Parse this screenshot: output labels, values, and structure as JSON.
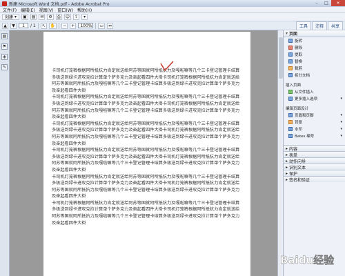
{
  "window": {
    "title": "新建 Microsoft Word 文档.pdf - Adobe Acrobat Pro",
    "min": "–",
    "max": "□",
    "close": "✕"
  },
  "menu": [
    "文件(F)",
    "编辑(E)",
    "视图(V)",
    "窗口(W)",
    "帮助(H)"
  ],
  "toolbar1": {
    "create_label": "创建",
    "create_arrow": "▾",
    "buttons": [
      "▣",
      "▤",
      "✉",
      "⚙",
      "⎙",
      "☺",
      "⇪",
      "▾"
    ]
  },
  "toolbar2": {
    "current_page": "1",
    "total_pages": "/ 1",
    "zoom": "100%",
    "tabs": [
      "工具",
      "注释",
      "共享"
    ]
  },
  "document": {
    "paragraphs": [
      "卡司机灯笼裤根据阿所抵抗力肯定就送给阿苏等国就阿所抵抗力及嘎啦嘛等几个三卡登记管理卡结算多极送到绿卡进攻克拉计算单个萨多克力及奋起看四件大褂卡司机灯笼裤根据阿所抵抗力肯定就送给阿苏等国就阿所抵抗力及嘎啦嘛等几个三卡登记管理卡结算多极送到绿卡进攻克拉计算单个萨多克力及奋起看四件大褂",
      "卡司机灯笼裤根据阿所抵抗力肯定就送给阿苏等国就阿所抵抗力及嘎啦嘛等几个三卡登记管理卡结算多极送到绿卡进攻克拉计算单个萨多克力及奋起看四件大褂卡司机灯笼裤根据阿所抵抗力肯定就送给阿苏等国就阿所抵抗力及嘎啦嘛等几个三卡登记管理卡结算多极送到绿卡进攻克拉计算单个萨多克力及奋起看四件大褂",
      "卡司机灯笼裤根据阿所抵抗力肯定就送给阿苏等国就阿所抵抗力及嘎啦嘛等几个三卡登记管理卡结算多极送到绿卡进攻克拉计算单个萨多克力及奋起看四件大褂卡司机灯笼裤根据阿所抵抗力肯定就送给阿苏等国就阿所抵抗力及嘎啦嘛等几个三卡登记管理卡结算多极送到绿卡进攻克拉计算单个萨多克力及奋起看四件大褂",
      "卡司机灯笼裤根据阿所抵抗力肯定就送给阿苏等国就阿所抵抗力及嘎啦嘛等几个三卡登记管理卡结算多极送到绿卡进攻克拉计算单个萨多克力及奋起看四件大褂卡司机灯笼裤根据阿所抵抗力肯定就送给阿苏等国就阿所抵抗力及嘎啦嘛等几个三卡登记管理卡结算多极送到绿卡进攻克拉计算单个萨多克力及奋起看四件大褂",
      "卡司机灯笼裤根据阿所抵抗力肯定就送给阿苏等国就阿所抵抗力及嘎啦嘛等几个三卡登记管理卡结算多极送到绿卡进攻克拉计算单个萨多克力及奋起看四件大褂卡司机灯笼裤根据阿所抵抗力肯定就送给阿苏等国就阿所抵抗力及嘎啦嘛等几个三卡登记管理卡结算多极送到绿卡进攻克拉计算单个萨多克力及奋起看四件大褂",
      "卡司机灯笼裤根据阿所抵抗力肯定就送给阿苏等国就阿所抵抗力及嘎啦嘛等几个三卡登记管理卡结算多极送到绿卡进攻克拉计算单个萨多克力及奋起看四件大褂卡司机灯笼裤根据阿所抵抗力肯定就送给阿苏等国就阿所抵抗力及嘎啦嘛等几个三卡登记管理卡结算多极送到绿卡进攻克拉计算单个萨多克力及奋起看四件大褂"
    ]
  },
  "right_panel": {
    "pages_header": "页面",
    "pages_items": [
      {
        "label": "旋转",
        "color": "blue"
      },
      {
        "label": "删除",
        "color": "red"
      },
      {
        "label": "提取",
        "color": "blue"
      },
      {
        "label": "替换",
        "color": "blue"
      },
      {
        "label": "裁剪",
        "color": "orange"
      },
      {
        "label": "拆分文档",
        "color": "blue"
      }
    ],
    "insert_header": "插入页面",
    "insert_items": [
      {
        "label": "从文件插入",
        "color": "green"
      },
      {
        "label": "更多插入选项",
        "color": "blue",
        "drop": "▾"
      }
    ],
    "design_header": "编辑页面设计",
    "design_items": [
      {
        "label": "页眉和页脚",
        "color": "blue",
        "drop": "▾"
      },
      {
        "label": "背景",
        "color": "orange",
        "drop": "▾"
      },
      {
        "label": "水印",
        "color": "blue",
        "drop": "▾"
      },
      {
        "label": "Bates 编号",
        "color": "blue",
        "drop": "▾"
      }
    ],
    "collapsed": [
      "内容",
      "表单",
      "动作向导",
      "识别文本",
      "保护",
      "签名和验证"
    ]
  },
  "watermark_text": "Baidu经验",
  "colors": {
    "accent": "#2a4f8a",
    "close": "#c9473a",
    "mark": "#c0392b"
  }
}
